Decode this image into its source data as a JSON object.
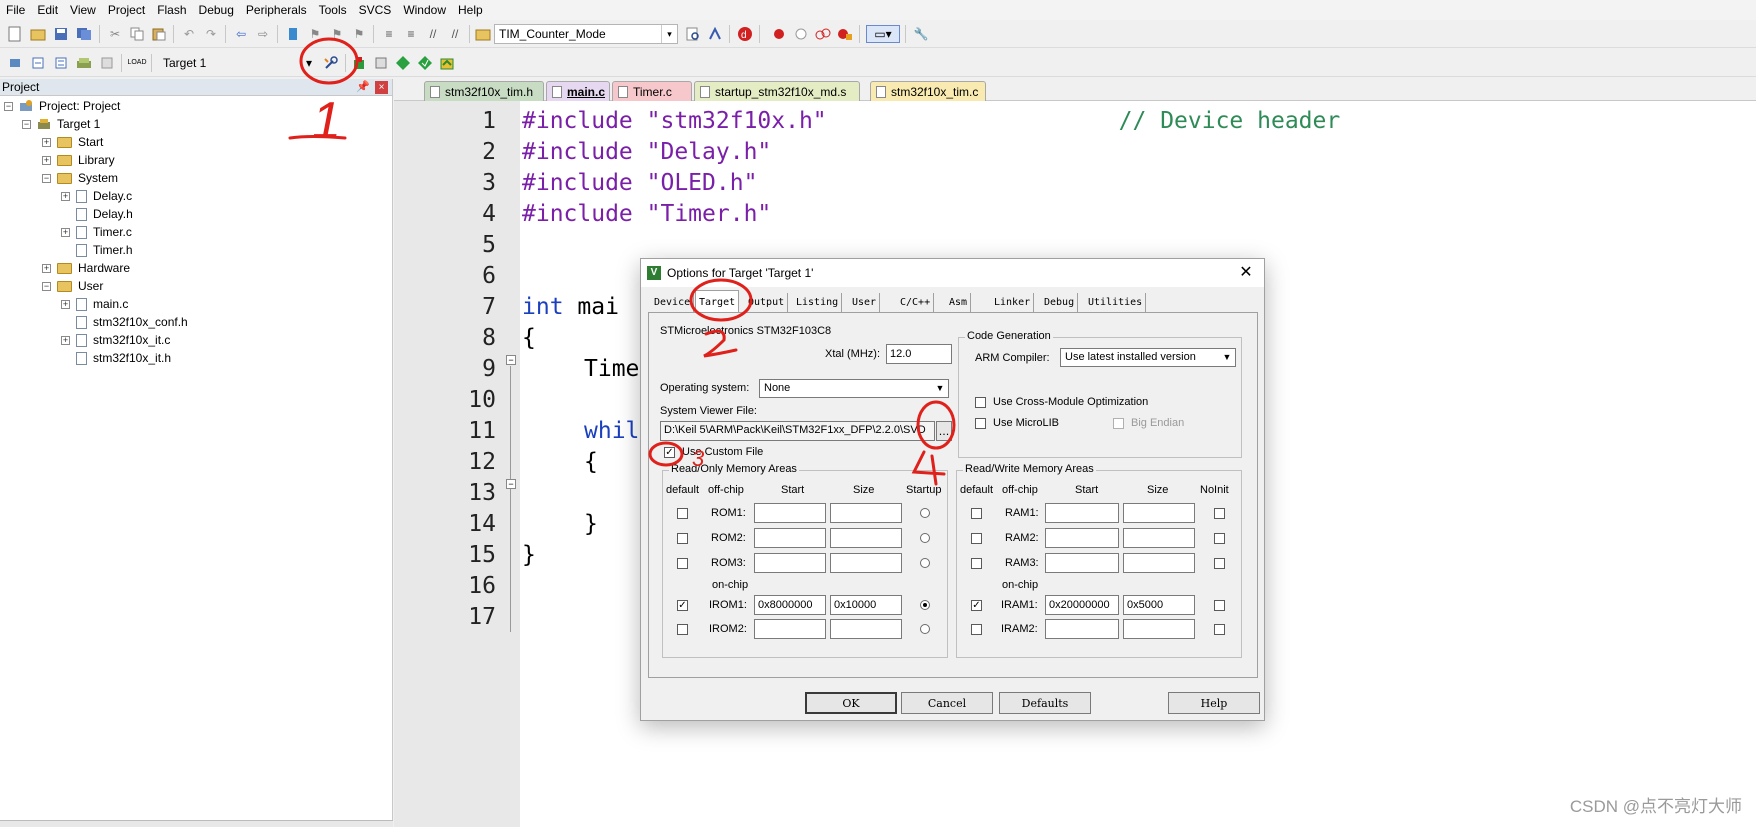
{
  "menu": [
    "File",
    "Edit",
    "View",
    "Project",
    "Flash",
    "Debug",
    "Peripherals",
    "Tools",
    "SVCS",
    "Window",
    "Help"
  ],
  "toolbar1": {
    "find_combo": "TIM_Counter_Mode"
  },
  "toolbar2": {
    "target_combo": "Target 1"
  },
  "project_panel": {
    "title": "Project",
    "tree": {
      "root": "Project: Project",
      "target": "Target 1",
      "groups": [
        {
          "name": "Start",
          "files": []
        },
        {
          "name": "Library",
          "files": []
        },
        {
          "name": "System",
          "files": [
            "Delay.c",
            "Delay.h",
            "Timer.c",
            "Timer.h"
          ]
        },
        {
          "name": "Hardware",
          "files": []
        },
        {
          "name": "User",
          "files": [
            "main.c",
            "stm32f10x_conf.h",
            "stm32f10x_it.c",
            "stm32f10x_it.h"
          ]
        }
      ]
    }
  },
  "editor": {
    "tabs": [
      "stm32f10x_tim.h",
      "main.c",
      "Timer.c",
      "startup_stm32f10x_md.s",
      "stm32f10x_tim.c"
    ],
    "active_tab": "main.c",
    "line_numbers": [
      "1",
      "2",
      "3",
      "4",
      "5",
      "6",
      "7",
      "8",
      "9",
      "10",
      "11",
      "12",
      "13",
      "14",
      "15",
      "16",
      "17"
    ],
    "lines": {
      "l1_kw": "#include",
      "l1_str": "\"stm32f10x.h\"",
      "l1_cmt": "// Device header",
      "l2_kw": "#include",
      "l2_str": "\"Delay.h\"",
      "l3_kw": "#include",
      "l3_str": "\"OLED.h\"",
      "l4_kw": "#include",
      "l4_str": "\"Timer.h\"",
      "l7_type": "int",
      "l7_rest": " mai",
      "l8": "{",
      "l9": "Time",
      "l11": "whil",
      "l12": "{",
      "l14": "}",
      "l15": "}"
    }
  },
  "dialog": {
    "title": "Options for Target 'Target 1'",
    "tabs": [
      "Device",
      "Target",
      "Output",
      "Listing",
      "User",
      "C/C++",
      "Asm",
      "Linker",
      "Debug",
      "Utilities"
    ],
    "active_tab": "Target",
    "device_name": "STMicroelectronics STM32F103C8",
    "xtal_label": "Xtal (MHz):",
    "xtal_value": "12.0",
    "os_label": "Operating system:",
    "os_value": "None",
    "svf_label": "System Viewer File:",
    "svf_value": "D:\\Keil 5\\ARM\\Pack\\Keil\\STM32F1xx_DFP\\2.2.0\\SVD",
    "browse_label": "...",
    "use_custom_file": "Use Custom File",
    "code_gen": {
      "title": "Code Generation",
      "compiler_label": "ARM Compiler:",
      "compiler_value": "Use latest installed version",
      "cross_module": "Use Cross-Module Optimization",
      "microlib": "Use MicroLIB",
      "big_endian": "Big Endian"
    },
    "ro": {
      "title": "Read/Only Memory Areas",
      "headers": [
        "default",
        "off-chip",
        "Start",
        "Size",
        "Startup"
      ],
      "onchip_label": "on-chip",
      "rows": [
        {
          "name": "ROM1:",
          "start": "",
          "size": "",
          "default": false,
          "startup": false
        },
        {
          "name": "ROM2:",
          "start": "",
          "size": "",
          "default": false,
          "startup": false
        },
        {
          "name": "ROM3:",
          "start": "",
          "size": "",
          "default": false,
          "startup": false
        },
        {
          "name": "IROM1:",
          "start": "0x8000000",
          "size": "0x10000",
          "default": true,
          "startup": true
        },
        {
          "name": "IROM2:",
          "start": "",
          "size": "",
          "default": false,
          "startup": false
        }
      ]
    },
    "rw": {
      "title": "Read/Write Memory Areas",
      "headers": [
        "default",
        "off-chip",
        "Start",
        "Size",
        "NoInit"
      ],
      "onchip_label": "on-chip",
      "rows": [
        {
          "name": "RAM1:",
          "start": "",
          "size": "",
          "default": false
        },
        {
          "name": "RAM2:",
          "start": "",
          "size": "",
          "default": false
        },
        {
          "name": "RAM3:",
          "start": "",
          "size": "",
          "default": false
        },
        {
          "name": "IRAM1:",
          "start": "0x20000000",
          "size": "0x5000",
          "default": true
        },
        {
          "name": "IRAM2:",
          "start": "",
          "size": "",
          "default": false
        }
      ]
    },
    "buttons": {
      "ok": "OK",
      "cancel": "Cancel",
      "defaults": "Defaults",
      "help": "Help"
    }
  },
  "annotations": {
    "a1": "1",
    "a2": "2",
    "a3": "3",
    "a4": "4",
    "color": "#e0201a"
  },
  "watermark": "CSDN @点不亮灯大师"
}
